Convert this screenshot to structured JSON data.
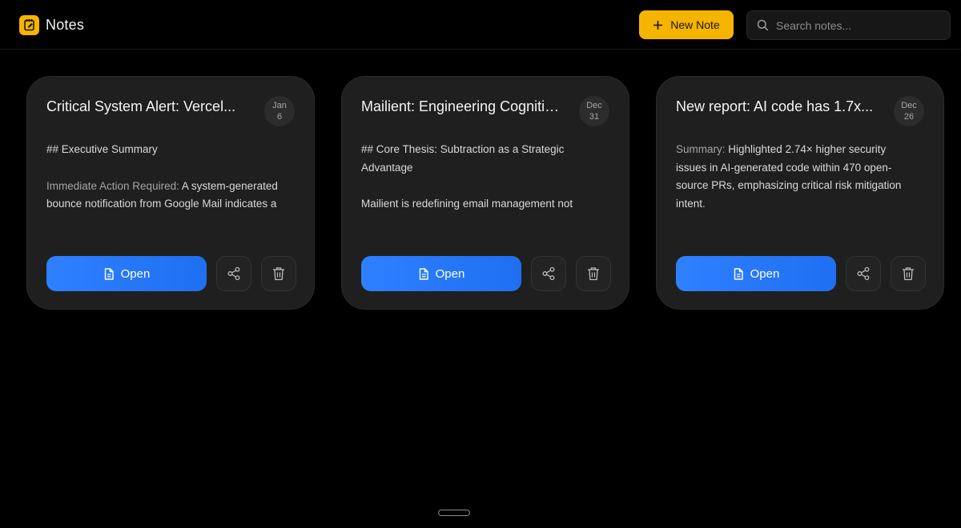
{
  "app": {
    "title": "Notes",
    "logo_icon": "note-edit-icon",
    "accent": "#f5b400"
  },
  "header": {
    "new_note_label": "New Note",
    "search_placeholder": "Search notes...",
    "search_value": ""
  },
  "notes": [
    {
      "title": "Critical System Alert: Vercel...",
      "date_month": "Jan",
      "date_day": "6",
      "line1": "## Executive Summary",
      "line2_label": "Immediate Action Required:",
      "line2_text": " A system-generated bounce notification from Google Mail indicates a",
      "open_label": "Open"
    },
    {
      "title": "Mailient: Engineering Cognitive...",
      "date_month": "Dec",
      "date_day": "31",
      "line1": "## Core Thesis: Subtraction as a Strategic Advantage",
      "line2_label": "",
      "line2_text": "Mailient is redefining email management not",
      "open_label": "Open"
    },
    {
      "title": "New report: AI code has 1.7x...",
      "date_month": "Dec",
      "date_day": "26",
      "line1_label": "Summary:",
      "line1": " Highlighted 2.74× higher security issues in AI-generated code within 470 open-source PRs, emphasizing critical risk mitigation intent.",
      "open_label": "Open"
    }
  ],
  "colors": {
    "open_button": "#2f80ff",
    "background": "#000000",
    "card": "#1f1f1f"
  }
}
